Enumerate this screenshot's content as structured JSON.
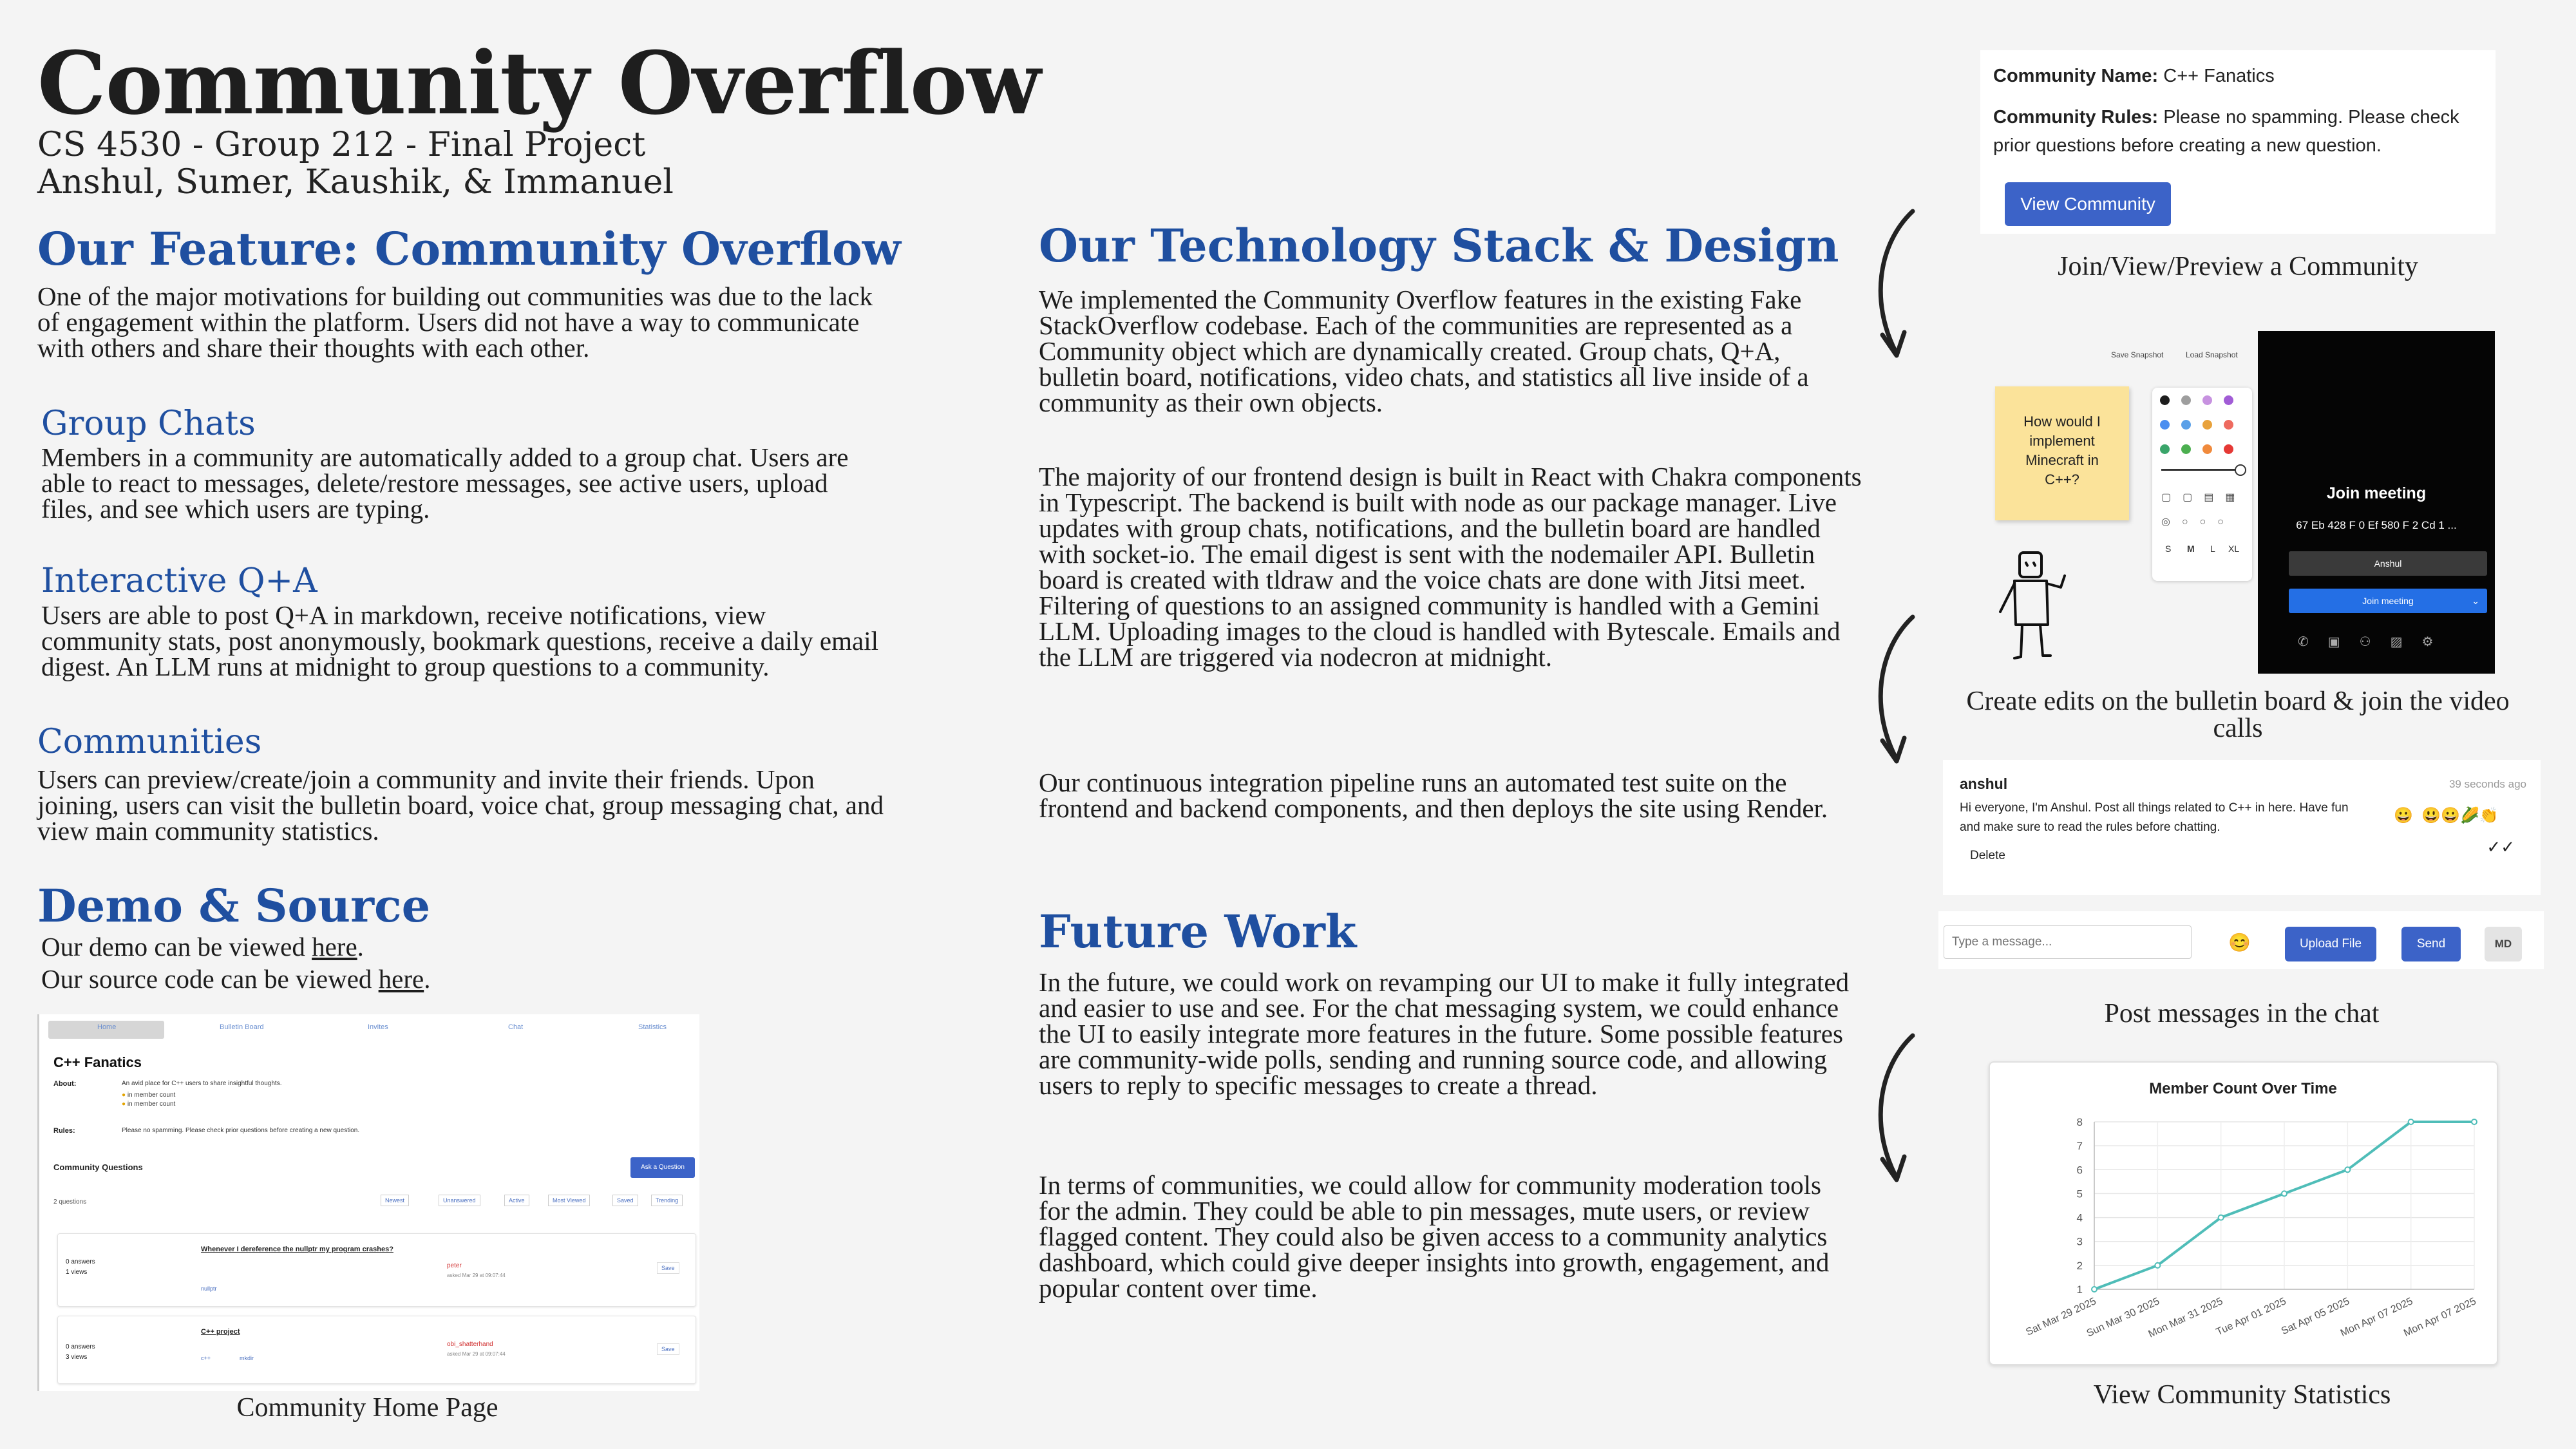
{
  "header": {
    "title": "Community Overflow",
    "subtitle1": "CS 4530 - Group 212 - Final Project",
    "subtitle2": "Anshul, Sumer, Kaushik, & Immanuel"
  },
  "feature": {
    "heading": "Our Feature: Community Overflow",
    "intro": "One of the major motivations for building out communities was due to the lack of engagement within the platform. Users did not have a way to communicate with others and share their thoughts with each other.",
    "group_chats_heading": "Group Chats",
    "group_chats_text": "Members in a community are automatically added to a group chat. Users are able to react to messages, delete/restore messages, see active users, upload files, and see which users are typing.",
    "qa_heading": "Interactive Q+A",
    "qa_text": "Users are able to post Q+A in markdown, receive notifications, view community stats, post anonymously, bookmark questions, receive a daily email digest. An LLM runs at midnight to group questions to a community.",
    "communities_heading": "Communities",
    "communities_text": "Users can preview/create/join a community and invite their friends. Upon joining, users can visit the bulletin board, voice chat, group messaging chat, and view main community statistics."
  },
  "demo": {
    "heading": "Demo & Source",
    "demo_prefix": "Our demo can be viewed ",
    "demo_link": "here",
    "source_prefix": "Our source code can be viewed ",
    "source_link": "here",
    "period": "."
  },
  "home_page": {
    "tabs": [
      "Home",
      "Bulletin Board",
      "Invites",
      "Chat",
      "Statistics"
    ],
    "community_name": "C++ Fanatics",
    "about_label": "About:",
    "about_text": "An avid place for C++ users to share insightful thoughts.",
    "member_count_1": "in member count",
    "member_count_2": "in member count",
    "rules_label": "Rules:",
    "rules_text": "Please no spamming. Please check prior questions before creating a new question.",
    "questions_heading": "Community Questions",
    "ask_button": "Ask a Question",
    "question_count": "2 questions",
    "filters": [
      "Newest",
      "Unanswered",
      "Active",
      "Most Viewed",
      "Saved",
      "Trending"
    ],
    "questions": [
      {
        "answers": "0 answers",
        "views": "1 views",
        "title": "Whenever I dereference the nullptr my program crashes?",
        "tag": "nullptr",
        "author": "peter",
        "asked": "asked Mar 29 at 09:07:44",
        "save": "Save"
      },
      {
        "answers": "0 answers",
        "views": "3 views",
        "title": "C++ project",
        "tag": "c++",
        "tag2": "mkdir",
        "author": "obi_shatterhand",
        "asked": "asked Mar 29 at 09:07:44",
        "save": "Save"
      }
    ],
    "caption": "Community Home Page"
  },
  "tech": {
    "heading": "Our Technology Stack & Design",
    "p1": "We implemented the Community Overflow features in the existing Fake StackOverflow codebase. Each of the communities are represented as a Community object which are dynamically created. Group chats, Q+A, bulletin board, notifications, video chats, and statistics all live inside of a community as their own objects.",
    "p2": "The majority of our frontend design is built in React with Chakra components in Typescript. The backend is built with node as our package manager. Live updates with group chats, notifications, and the bulletin board are handled with socket-io. The email digest is sent with the nodemailer API. Bulletin board is created with tldraw and the voice chats are done with Jitsi meet. Filtering of questions to an assigned community is handled with a Gemini LLM. Uploading images to the cloud is handled with Bytescale. Emails and the LLM are triggered via nodecron at midnight.",
    "p3": "Our continuous integration pipeline runs an automated test suite on the frontend and backend components, and then deploys the site using Render."
  },
  "future": {
    "heading": "Future Work",
    "p1": "In the future, we could work on revamping our UI to make it fully integrated and easier to use and see. For the chat messaging system, we could enhance the UI to easily integrate more features in the future. Some possible features are community-wide polls, sending and running source code, and allowing users to reply to specific messages to create a thread.",
    "p2": "In terms of communities, we could allow for community moderation tools for the admin. They could be able to pin messages, mute users, or review flagged content. They could also be given access to a community analytics dashboard, which could give deeper insights into growth, engagement, and popular content over time."
  },
  "preview": {
    "name_label": "Community Name:",
    "name_value": "C++ Fanatics",
    "rules_label": "Community Rules:",
    "rules_value": "Please no spamming. Please check prior questions before creating a new question.",
    "button": "View Community",
    "caption": "Join/View/Preview a Community"
  },
  "bulletin": {
    "save_snapshot": "Save Snapshot",
    "load_snapshot": "Load Snapshot",
    "sticky_note": "How would I implement Minecraft in C++?",
    "size_labels": [
      "S",
      "M",
      "L",
      "XL"
    ],
    "palette": [
      "#1d1d1d",
      "#9e9e9e",
      "#c792e0",
      "#a15cd6",
      "#4b8ef0",
      "#5aa0e8",
      "#e8a23c",
      "#ee6a5f",
      "#3aa56a",
      "#4caf50",
      "#f08a3c",
      "#e53935"
    ],
    "join_title": "Join meeting",
    "meeting_id": "67 Eb 428 F 0 Ef 580 F 2 Cd 1 ...",
    "user_name": "Anshul",
    "join_button": "Join meeting",
    "caption": "Create edits on the bulletin board & join the video calls"
  },
  "chat": {
    "user": "anshul",
    "time": "39 seconds ago",
    "message": "Hi everyone, I'm Anshul. Post all things related to C++ in here. Have fun and make sure to read the rules before chatting.",
    "delete_label": "Delete",
    "check_marks": "✓✓",
    "input_placeholder": "Type a message...",
    "upload_button": "Upload File",
    "send_button": "Send",
    "md_button": "MD",
    "caption": "Post messages in the chat"
  },
  "chart_data": {
    "type": "line",
    "title": "Member Count Over Time",
    "categories": [
      "Sat Mar 29 2025",
      "Sun Mar 30 2025",
      "Mon Mar 31 2025",
      "Tue Apr 01 2025",
      "Sat Apr 05 2025",
      "Mon Apr 07 2025",
      "Mon Apr 07 2025"
    ],
    "values": [
      1,
      2,
      4,
      5,
      6,
      8,
      8
    ],
    "ylim": [
      1,
      8
    ],
    "yticks": [
      1,
      2,
      3,
      4,
      5,
      6,
      7,
      8
    ],
    "color": "#4fbdb8",
    "grid": true
  },
  "stats": {
    "caption": "View Community Statistics"
  }
}
